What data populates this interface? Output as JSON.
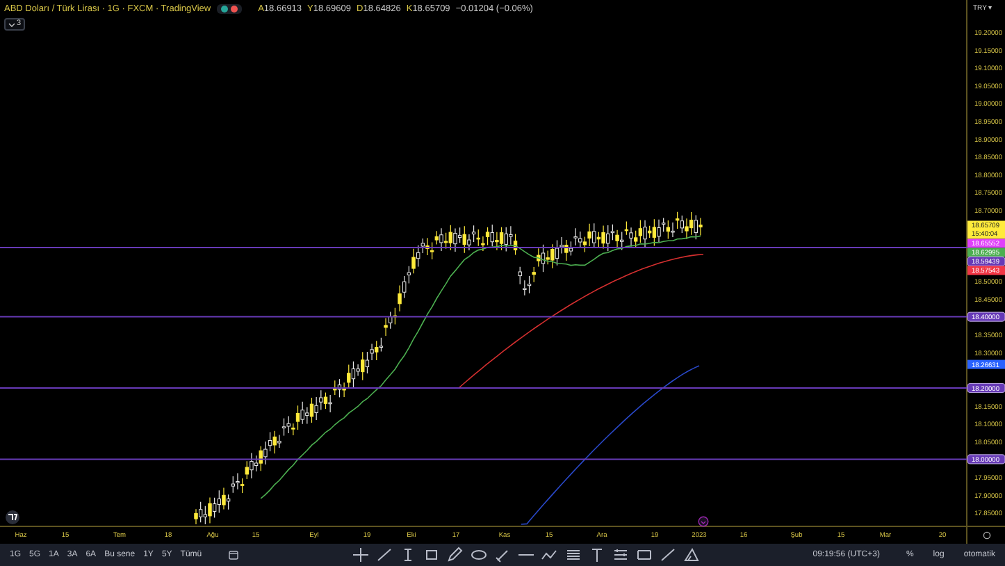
{
  "header": {
    "title": "ABD Doları / Türk Lirası · 1G · FXCM · TradingView",
    "status_dots": [
      {
        "color": "#26a69a"
      },
      {
        "color": "#ef5350"
      }
    ],
    "ohlc": [
      {
        "label": "A",
        "value": "18.66913"
      },
      {
        "label": "Y",
        "value": "18.69609"
      },
      {
        "label": "D",
        "value": "18.64826"
      },
      {
        "label": "K",
        "value": "18.65709"
      }
    ],
    "change": "−0.01204 (−0.06%)",
    "indicator_count": "3"
  },
  "price_axis": {
    "currency": "TRY ▾",
    "ticks": [
      "19.20000",
      "19.15000",
      "19.10000",
      "19.05000",
      "19.00000",
      "18.95000",
      "18.90000",
      "18.85000",
      "18.80000",
      "18.75000",
      "18.70000",
      "18.50000",
      "18.45000",
      "18.35000",
      "18.30000",
      "18.15000",
      "18.10000",
      "18.05000",
      "17.95000",
      "17.90000",
      "17.85000"
    ],
    "tags": [
      {
        "price": "18.65709",
        "sub": "15:40:04",
        "color": "#ffeb3b",
        "line": false
      },
      {
        "price": "18.65552",
        "color": "#e040fb",
        "line": false
      },
      {
        "price": "18.62995",
        "color": "#4caf50",
        "line": false
      },
      {
        "price": "18.59439",
        "color": "#673ab7",
        "line": true
      },
      {
        "price": "18.57543",
        "color": "#f23645",
        "line": false
      },
      {
        "price": "18.40000",
        "color": "#673ab7",
        "line": true
      },
      {
        "price": "18.26631",
        "color": "#2962ff",
        "line": false
      },
      {
        "price": "18.20000",
        "color": "#673ab7",
        "line": true
      },
      {
        "price": "18.00000",
        "color": "#673ab7",
        "line": true
      }
    ]
  },
  "time_axis": [
    "Haz",
    "15",
    "Tem",
    "18",
    "Ağu",
    "15",
    "Eyl",
    "19",
    "Eki",
    "17",
    "Kas",
    "15",
    "Ara",
    "19",
    "2023",
    "16",
    "Şub",
    "15",
    "Mar",
    "20"
  ],
  "toolbar": {
    "ranges": [
      "1G",
      "5G",
      "1A",
      "3A",
      "6A",
      "Bu sene",
      "1Y",
      "5Y",
      "Tümü"
    ],
    "clock": "09:19:56 (UTC+3)",
    "percent": "%",
    "log": "log",
    "auto": "otomatik"
  }
}
